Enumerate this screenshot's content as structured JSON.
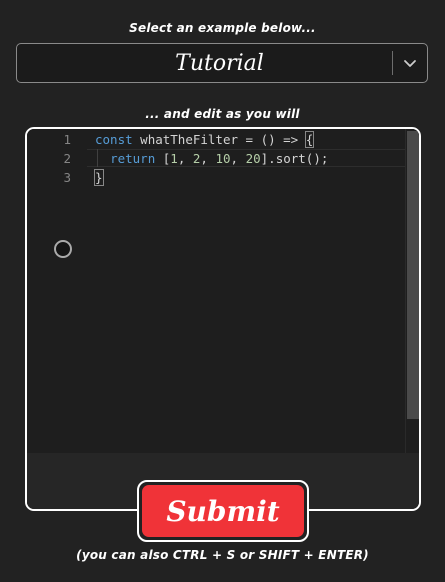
{
  "header": {
    "select_hint": "Select an example below...",
    "edit_hint": "... and edit as you will"
  },
  "example_select": {
    "selected": "Tutorial",
    "arrow_icon": "chevron-down-icon"
  },
  "editor": {
    "line_numbers": [
      "1",
      "2",
      "3"
    ],
    "lines": {
      "line1": {
        "keyword": "const",
        "rest": " whatTheFilter = () => ",
        "brace": "{"
      },
      "line2": {
        "indent": "  ",
        "keyword": "return",
        "open": " [",
        "n1": "1",
        "c1": ", ",
        "n2": "2",
        "c2": ", ",
        "n3": "10",
        "c3": ", ",
        "n4": "20",
        "close": "].sort();"
      },
      "line3": {
        "brace": "}"
      }
    },
    "colors": {
      "keyword": "#569cd6",
      "number": "#b5cea8",
      "text": "#d4d4d4",
      "background": "#1e1e1e"
    }
  },
  "submit": {
    "label": "Submit",
    "color": "#f03338"
  },
  "footer": {
    "shortcut_hint": "(you can also CTRL + S or SHIFT + ENTER)"
  }
}
